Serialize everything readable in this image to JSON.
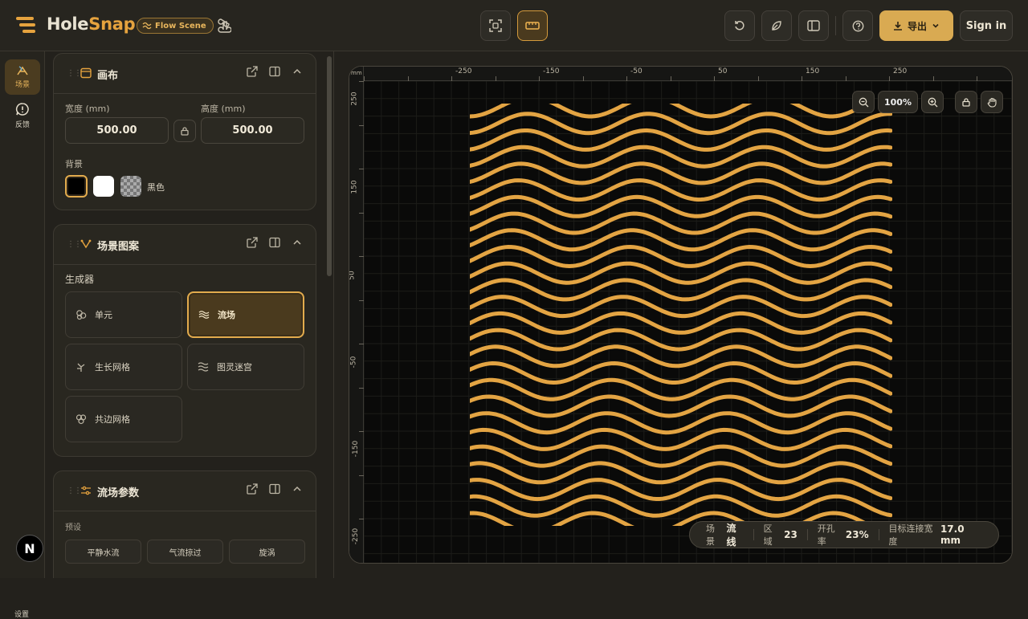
{
  "header": {
    "brand_hole": "Hole",
    "brand_snap": "Snap",
    "scene_badge": "Flow Scene",
    "export_label": "导出",
    "signin_label": "Sign in"
  },
  "rail": {
    "items": [
      {
        "label": "场景",
        "icon": "scene-icon"
      },
      {
        "label": "反馈",
        "icon": "feedback-icon"
      }
    ],
    "bottom_label": "设置",
    "bottom_badge": "N"
  },
  "canvas_panel": {
    "title": "画布",
    "width_label": "宽度 (mm)",
    "height_label": "高度 (mm)",
    "width_value": "500.00",
    "height_value": "500.00",
    "background_label": "背景",
    "background_value": "黑色"
  },
  "pattern_panel": {
    "title": "场景图案",
    "generator_label": "生成器",
    "generators": [
      {
        "label": "单元",
        "icon": "cells-icon",
        "active": false
      },
      {
        "label": "流场",
        "icon": "flow-icon",
        "active": true
      },
      {
        "label": "生长网格",
        "icon": "growth-icon",
        "active": false
      },
      {
        "label": "图灵迷宫",
        "icon": "maze-icon",
        "active": false
      },
      {
        "label": "共边网格",
        "icon": "shared-edge-icon",
        "active": false
      }
    ]
  },
  "flow_panel": {
    "title": "流场参数",
    "preset_label": "预设",
    "presets": [
      "平静水流",
      "气流掠过",
      "旋涡"
    ]
  },
  "canvas": {
    "ruler_unit": "mm",
    "top_ticks": [
      "-250",
      "-150",
      "-50",
      "50",
      "150",
      "250"
    ],
    "left_ticks": [
      "250",
      "150",
      "50",
      "-50",
      "-150",
      "-250"
    ],
    "zoom": "100%",
    "wave_color": "#e3a443",
    "wave_count": 26
  },
  "status": {
    "scene_label": "场景",
    "scene_value": "流线",
    "region_label": "区域",
    "region_value": "23",
    "open_label": "开孔率",
    "open_value": "23%",
    "width_label": "目标连接宽度",
    "width_value": "17.0 mm"
  }
}
